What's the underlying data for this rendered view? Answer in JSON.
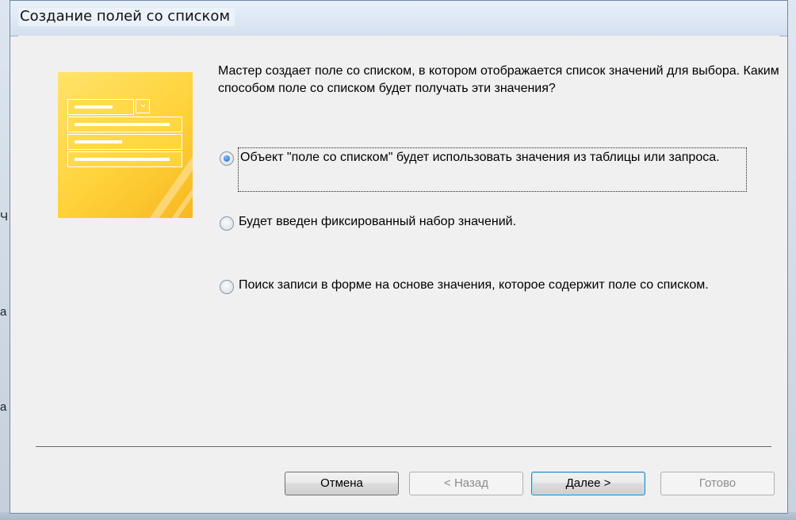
{
  "window": {
    "title": "Создание полей со списком"
  },
  "wizard": {
    "intro": "Мастер создает поле со списком, в котором отображается список значений для выбора.  Каким способом поле со списком будет получать эти значения?",
    "options": [
      {
        "label": "Объект \"поле со списком\" будет использовать значения из таблицы или запроса.",
        "selected": true
      },
      {
        "label": "Будет введен фиксированный набор значений.",
        "selected": false
      },
      {
        "label": "Поиск записи в форме на основе значения, которое содержит поле со списком.",
        "selected": false
      }
    ]
  },
  "buttons": {
    "cancel": "Отмена",
    "back": "< Назад",
    "next": "Далее >",
    "finish": "Готово"
  },
  "background": {
    "left_fragments": [
      "Ч",
      "а",
      "а"
    ]
  },
  "colors": {
    "accent": "#3c7fb1",
    "illustration": "#ffd23a",
    "dialog_bg": "#f0f0f0"
  }
}
